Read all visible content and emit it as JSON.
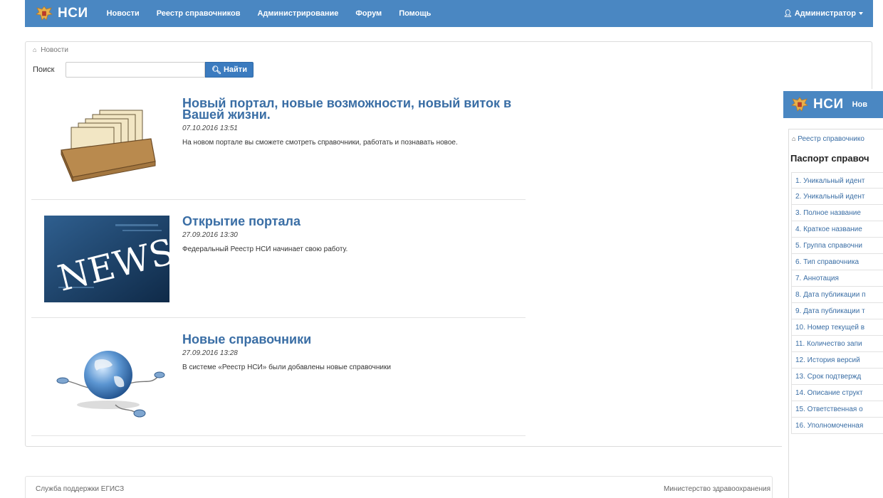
{
  "navbar": {
    "brand": "НСИ",
    "items": [
      "Новости",
      "Реестр справочников",
      "Администрирование",
      "Форум",
      "Помощь"
    ],
    "user": "Администратор"
  },
  "breadcrumb": "Новости",
  "search": {
    "label": "Поиск",
    "value": "",
    "button": "Найти"
  },
  "news": [
    {
      "title": "Новый портал, новые возможности, новый виток в Вашей жизни.",
      "date": "07.10.2016 13:51",
      "text": "На новом портале вы сможете смотреть справочники, работать и познавать новое."
    },
    {
      "title": "Открытие портала",
      "date": "27.09.2016 13:30",
      "text": "Федеральный Реестр НСИ начинает свою работу.",
      "image_text": "NEWS"
    },
    {
      "title": "Новые справочники",
      "date": "27.09.2016 13:28",
      "text": "В системе «Реестр НСИ» были добавлены новые справочники"
    }
  ],
  "footer": {
    "left": "Служба поддержки ЕГИСЗ",
    "right": "Министерство здравоохранения"
  },
  "side_window": {
    "brand": "НСИ",
    "nav_item": "Нов",
    "breadcrumb": "Реестр справочнико",
    "heading": "Паспорт справоч",
    "rows": [
      "1. Уникальный идент",
      "2. Уникальный идент",
      "3. Полное название",
      "4. Краткое название",
      "5. Группа справочни",
      "6. Тип справочника",
      "7. Аннотация",
      "8. Дата публикации п",
      "9. Дата публикации т",
      "10. Номер текущей в",
      "11. Количество запи",
      "12. История версий",
      "13. Срок подтвержд",
      "14. Описание структ",
      "15. Ответственная о",
      "16. Уполномоченная"
    ]
  },
  "colors": {
    "navbar": "#4a87c2",
    "link": "#3a6ea5",
    "button": "#3b7bbf"
  }
}
